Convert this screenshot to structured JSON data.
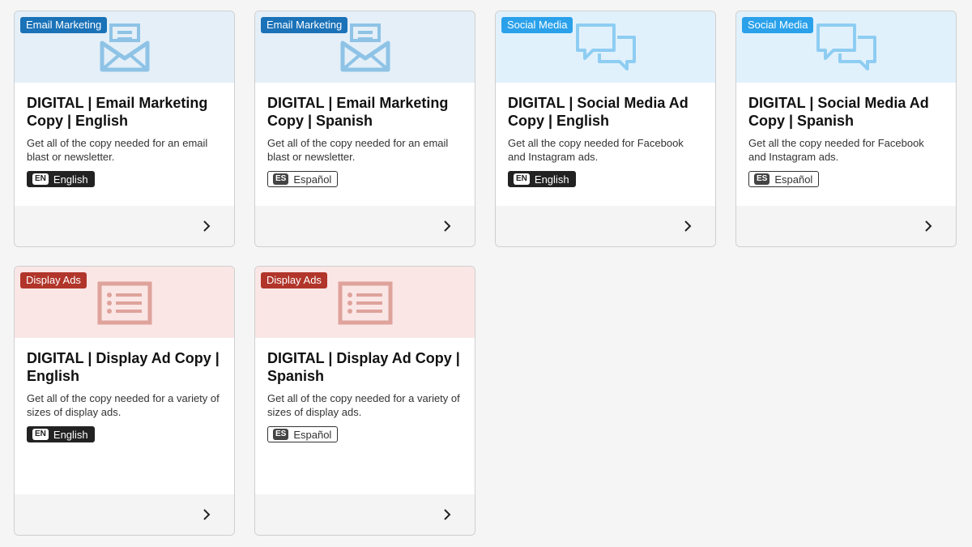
{
  "cards": [
    {
      "category": "Email Marketing",
      "title": "DIGITAL | Email Marketing Copy | English",
      "description": "Get all of the copy needed for an email blast or newsletter.",
      "lang_code": "EN",
      "lang_label": "English",
      "icon": "envelope-icon"
    },
    {
      "category": "Email Marketing",
      "title": "DIGITAL | Email Marketing Copy | Spanish",
      "description": "Get all of the copy needed for an email blast or newsletter.",
      "lang_code": "ES",
      "lang_label": "Español",
      "icon": "envelope-icon"
    },
    {
      "category": "Social Media",
      "title": "DIGITAL | Social Media Ad Copy | English",
      "description": "Get all the copy needed for Facebook and Instagram ads.",
      "lang_code": "EN",
      "lang_label": "English",
      "icon": "chat-bubbles-icon"
    },
    {
      "category": "Social Media",
      "title": "DIGITAL | Social Media Ad Copy | Spanish",
      "description": "Get all the copy needed for Facebook and Instagram ads.",
      "lang_code": "ES",
      "lang_label": "Español",
      "icon": "chat-bubbles-icon"
    },
    {
      "category": "Display Ads",
      "title": "DIGITAL | Display Ad Copy | English",
      "description": "Get all of the copy needed for a variety of sizes of display ads.",
      "lang_code": "EN",
      "lang_label": "English",
      "icon": "list-icon"
    },
    {
      "category": "Display Ads",
      "title": "DIGITAL | Display Ad Copy | Spanish",
      "description": "Get all of the copy needed for a variety of sizes of display ads.",
      "lang_code": "ES",
      "lang_label": "Español",
      "icon": "list-icon"
    }
  ],
  "colors": {
    "email_badge": "#1a72b8",
    "social_badge": "#2aa1ea",
    "display_badge": "#b1352a"
  }
}
